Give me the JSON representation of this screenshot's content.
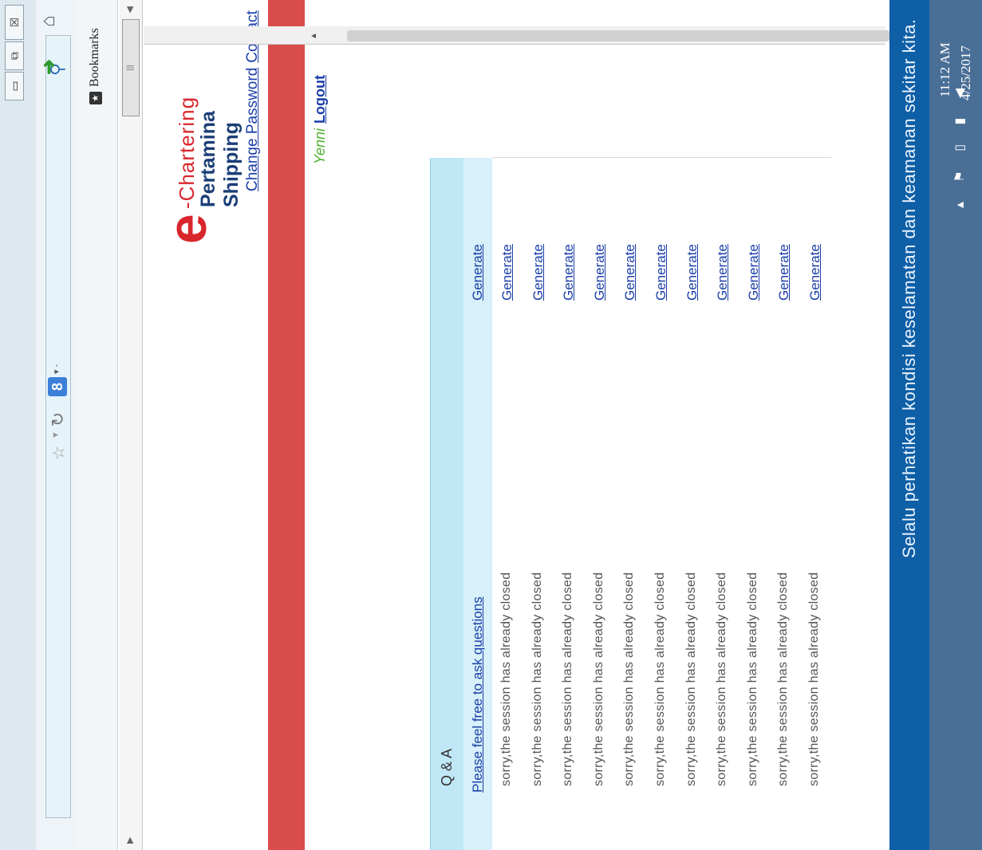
{
  "browser": {
    "window_controls": {
      "minimize": "▭",
      "restore": "⧉",
      "close": "☒"
    },
    "search_engine_glyph": "8",
    "bookmarks_label": "Bookmarks"
  },
  "site": {
    "logo": {
      "e": "e",
      "chartering": "-Chartering",
      "shipping": "Pertamina Shipping"
    },
    "nav": {
      "change_password": "Change Password",
      "contact": "Contact"
    },
    "user": {
      "name": "Yenni",
      "logout": "Logout"
    },
    "qa": {
      "title": "Q & A",
      "ask_link": "Please feel free to ask questions",
      "generate_header": "Generate",
      "rows": [
        {
          "text": "sorry,the session has already closed",
          "action": "Generate"
        },
        {
          "text": "sorry,the session has already closed",
          "action": "Generate"
        },
        {
          "text": "sorry,the session has already closed",
          "action": "Generate"
        },
        {
          "text": "sorry,the session has already closed",
          "action": "Generate"
        },
        {
          "text": "sorry,the session has already closed",
          "action": "Generate"
        },
        {
          "text": "sorry,the session has already closed",
          "action": "Generate"
        },
        {
          "text": "sorry,the session has already closed",
          "action": "Generate"
        },
        {
          "text": "sorry,the session has already closed",
          "action": "Generate"
        },
        {
          "text": "sorry,the session has already closed",
          "action": "Generate"
        },
        {
          "text": "sorry,the session has already closed",
          "action": "Generate"
        },
        {
          "text": "sorry,the session has already closed",
          "action": "Generate"
        }
      ]
    }
  },
  "taskbar": {
    "ticker": "Selalu perhatikan kondisi keselamatan dan keamanan sekitar kita.",
    "time": "11:12 AM",
    "date": "4/25/2017"
  },
  "colors": {
    "brand_red": "#d9262c",
    "brand_navy": "#1b3f77",
    "bar_red": "#d94c4c",
    "header_blue": "#bfe7f5",
    "link": "#1a3ea8",
    "taskbar": "#0f5fa6"
  }
}
